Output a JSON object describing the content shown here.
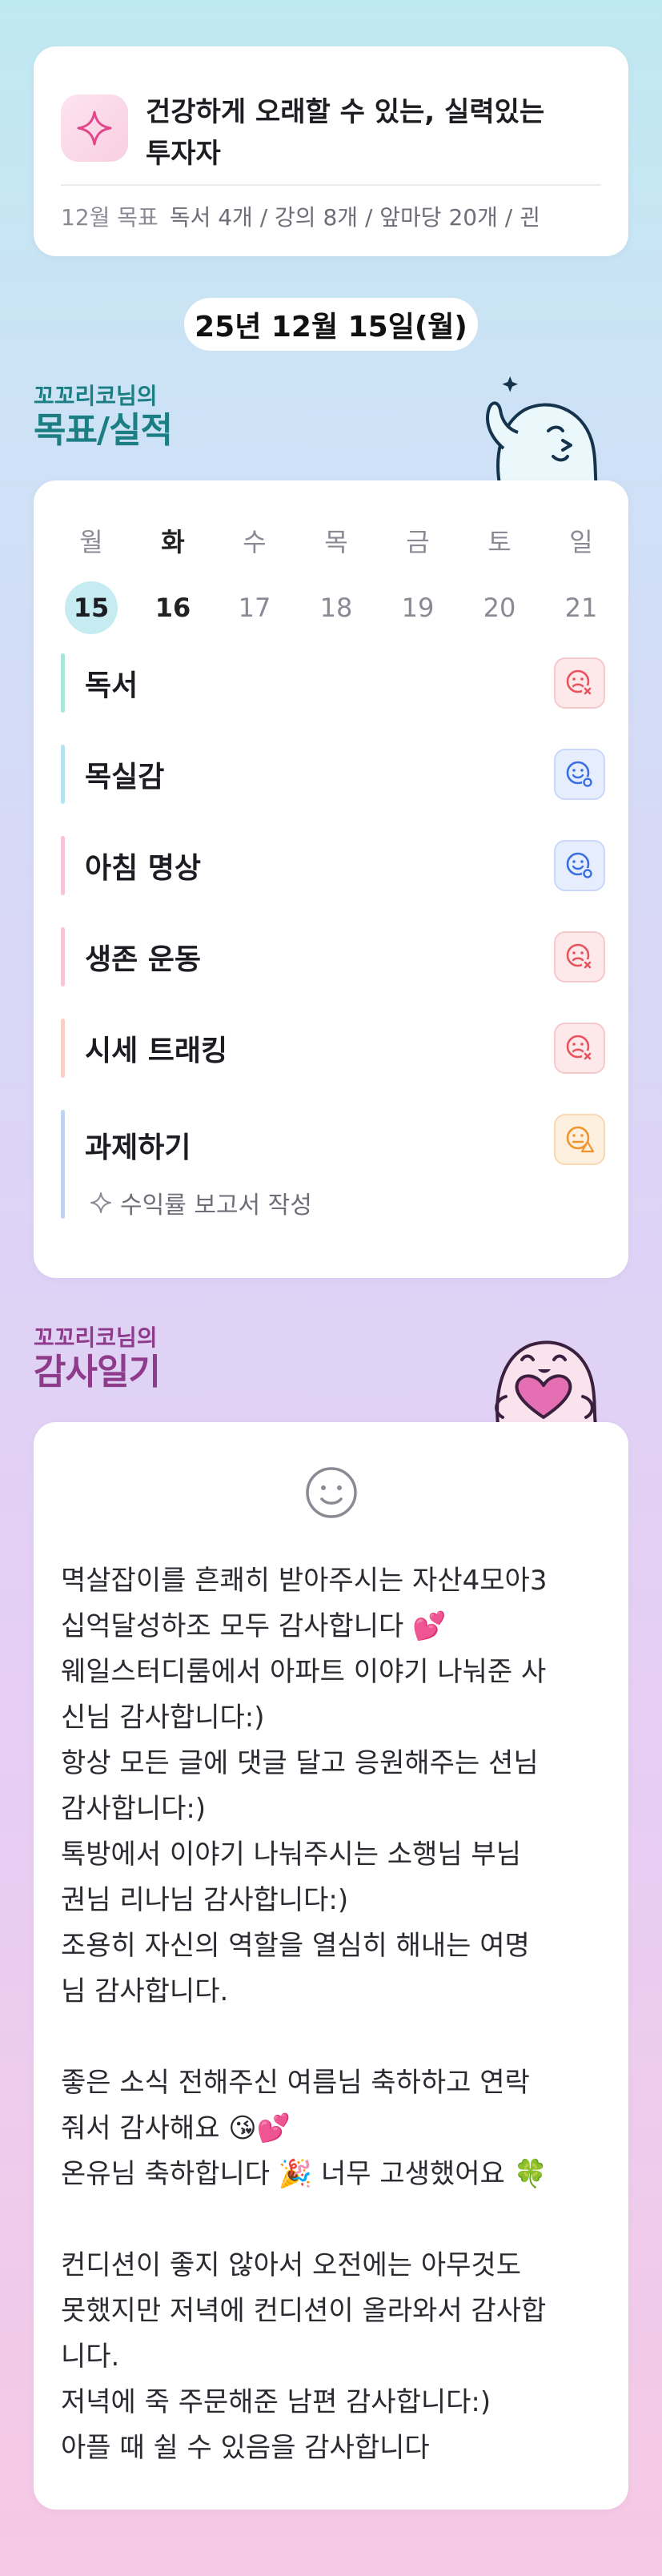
{
  "goal": {
    "icon": "sparkle-icon",
    "title_line1": "건강하게 오래할 수 있는, 실력있는",
    "title_line2": "투자자",
    "month_label": "12월 목표",
    "targets": "독서 4개 / 강의 8개 / 앞마당 20개 / 괸"
  },
  "date": "25년 12월 15일(월)",
  "tracker_section": {
    "small": "꼬꼬리코님의",
    "big": "목표/실적",
    "mascot": "waving-ghost-mascot"
  },
  "week": {
    "days": [
      "월",
      "화",
      "수",
      "목",
      "금",
      "토",
      "일"
    ],
    "dates": [
      "15",
      "16",
      "17",
      "18",
      "19",
      "20",
      "21"
    ],
    "selected_index": 0
  },
  "habits": [
    {
      "label": "독서",
      "status": "fail",
      "icon": "sad-face-x-icon",
      "bar_color": "#a8e6da"
    },
    {
      "label": "목실감",
      "status": "good",
      "icon": "smile-face-check-icon",
      "bar_color": "#b6e3f0"
    },
    {
      "label": "아침 명상",
      "status": "good",
      "icon": "smile-face-check-icon",
      "bar_color": "#f6c3db"
    },
    {
      "label": "생존 운동",
      "status": "fail",
      "icon": "sad-face-x-icon",
      "bar_color": "#f7c6d6"
    },
    {
      "label": "시세 트래킹",
      "status": "fail",
      "icon": "sad-face-x-icon",
      "bar_color": "#f8d0c4"
    },
    {
      "label": "과제하기",
      "status": "warn",
      "icon": "neutral-face-warning-icon",
      "bar_color": "#bfd3f2"
    }
  ],
  "habit_note": "수익률 보고서 작성",
  "diary_section": {
    "small": "꼬꼬리코님의",
    "big": "감사일기",
    "mascot": "heart-ghost-mascot"
  },
  "diary": {
    "mood_icon": "smile-outline-icon",
    "lines": [
      "멱살잡이를 흔쾌히 받아주시는 자산4모아3",
      "십억달성하조 모두 감사합니다 💕",
      "웨일스터디룸에서 아파트 이야기 나눠준 사",
      "신님 감사합니다:)",
      "항상 모든 글에 댓글 달고 응원해주는 션님",
      "감사합니다:)",
      "톡방에서 이야기 나눠주시는 소행님 부님",
      "권님 리나님 감사합니다:)",
      "조용히 자신의 역할을 열심히 해내는 여명",
      "님 감사합니다.",
      "",
      "좋은 소식 전해주신 여름님 축하하고 연락",
      "줘서 감사해요 😘💕",
      "온유님 축하합니다 🎉 너무 고생했어요 🍀",
      "",
      "컨디션이 좋지 않아서 오전에는 아무것도",
      "못했지만 저녁에 컨디션이 올라와서 감사합",
      "니다.",
      "저녁에 죽 주문해준 남편 감사합니다:)",
      "아플 때 쉴 수 있음을 감사합니다"
    ]
  },
  "colors": {
    "tracker_heading": "#1a7e82",
    "diary_heading": "#8e3b8c",
    "fail": "#e8545e",
    "good": "#3a6fe0",
    "warn": "#f0942e",
    "today_bg": "#c6ecf1"
  }
}
